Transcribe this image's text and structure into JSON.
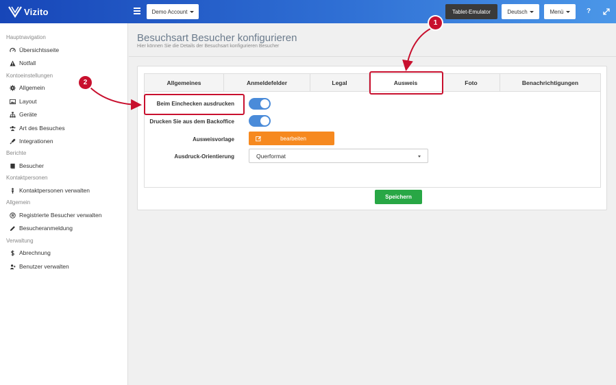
{
  "header": {
    "logo_text": "Vizito",
    "account_button": "Demo Account",
    "tablet_button": "Tablet-Emulator",
    "language_button": "Deutsch",
    "menu_button": "Menü",
    "help_icon_glyph": "?",
    "colors": {
      "gradient_start": "#1746b8",
      "gradient_end": "#4b97e8"
    }
  },
  "sidebar": {
    "sections": [
      {
        "label": "Hauptnavigation",
        "items": [
          {
            "label": "Übersichtsseite",
            "icon": "dashboard-icon"
          },
          {
            "label": "Notfall",
            "icon": "warning-icon"
          }
        ]
      },
      {
        "label": "Kontoeinstellungen",
        "items": [
          {
            "label": "Allgemein",
            "icon": "gear-icon"
          },
          {
            "label": "Layout",
            "icon": "image-icon"
          },
          {
            "label": "Geräte",
            "icon": "sitemap-icon"
          },
          {
            "label": "Art des Besuches",
            "icon": "users-icon"
          },
          {
            "label": "Integrationen",
            "icon": "plug-icon"
          }
        ]
      },
      {
        "label": "Berichte",
        "items": [
          {
            "label": "Besucher",
            "icon": "book-icon"
          }
        ]
      },
      {
        "label": "Kontaktpersonen",
        "items": [
          {
            "label": "Kontaktpersonen verwalten",
            "icon": "person-icon"
          }
        ]
      },
      {
        "label": "Allgemein",
        "items": [
          {
            "label": "Registrierte Besucher verwalten",
            "icon": "registered-icon"
          },
          {
            "label": "Besucheranmeldung",
            "icon": "pencil-icon"
          }
        ]
      },
      {
        "label": "Verwaltung",
        "items": [
          {
            "label": "Abrechnung",
            "icon": "dollar-icon"
          },
          {
            "label": "Benutzer verwalten",
            "icon": "user-plus-icon"
          }
        ]
      }
    ]
  },
  "main": {
    "title": "Besuchsart Besucher konfigurieren",
    "subtitle": "Hier können Sie die Details der Besuchsart konfigurieren Besucher",
    "tabs": [
      {
        "label": "Allgemeines",
        "active": false
      },
      {
        "label": "Anmeldefelder",
        "active": false
      },
      {
        "label": "Legal",
        "active": false
      },
      {
        "label": "Ausweis",
        "active": true
      },
      {
        "label": "Foto",
        "active": false
      },
      {
        "label": "Benachrichtigungen",
        "active": false
      }
    ],
    "form": {
      "print_on_checkin_label": "Beim Einchecken ausdrucken",
      "print_on_checkin_value": true,
      "print_from_backoffice_label": "Drucken Sie aus dem Backoffice",
      "print_from_backoffice_value": true,
      "badge_template_label": "Ausweisvorlage",
      "badge_template_button": "bearbeiten",
      "orientation_label": "Ausdruck-Orientierung",
      "orientation_value": "Querformat"
    },
    "save_button": "Speichern"
  },
  "annotations": {
    "marker_1": "1",
    "marker_2": "2",
    "color": "#c8102e"
  }
}
